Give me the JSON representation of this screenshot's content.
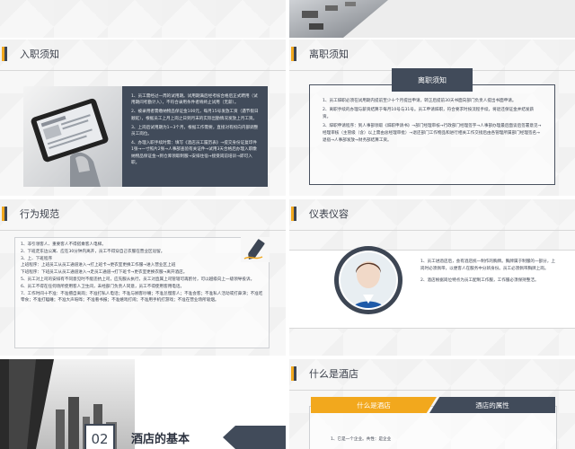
{
  "slides": {
    "ruzhi": {
      "title": "入职须知",
      "text": [
        "1、员工需经过一周的试用期。试用期满后经考核合格后正式聘用（试用期间考勤计入），不符合录用条件者将终止试用（无薪）。",
        "2、被录用者需缴纳物品保证金100元，每月15号发放工资（遇节假日顺延），根据员工上月上岗之日到月末的实际出勤情况发放上月工资。",
        "3、上岗后试用期为1~3个月，根据工作需要，直接对有权向内部调整员工岗位。",
        "4、办理入职手续时需：填写《酒店员工履历表》→提交身份证复印件1张→一寸照片2张→人事部查验有关证件→试用3天合格后办理入职缴纳物品保证金→到仓库领取制服→安排住宿→接受岗前培训→即可入职。"
      ]
    },
    "lizhi": {
      "title": "离职须知",
      "tag": "离职须知",
      "text": [
        "1、员工辞职必须在试用期内提前至少十个月提出申请，转正后提前30天书面向部门负责人提出书面申请。",
        "2、离职手续的办理与薪资结算于每月10号与31号。员工申请辞职，符合要求时按流程手续，将退还保证金并结发薪资。",
        "3、辞职申请程序：到人事部领取《辞职申请书》→部门经理审核→行政部门经理签字→人事部办理最后面谈后签署意见→经理审核（主管级（含）以上需由总经理审批）→退还部门工作物品和进行相关工作交接后由各管理所属部门经理签名→退宿→人事部发放→财务部结算工资。"
      ]
    },
    "xingwei": {
      "title": "行为规范",
      "text": [
        "1、非引领客人、重要客人不得搭乘客人电梯。",
        "2、下班走东边公寓、应在30分钟内离开，员工不得穿自己衣服在营业区逗留。",
        "3、上、下班程序",
        "上班程序：上班员工从员工通道进入→打上班卡→更衣室更换工作服→进入营业区上班",
        "下班程序：下班员工从员工通道进入→走员工通道→打下班卡→更衣室更换衣服→离开酒店。",
        "5、员工对上司的安排有不同意见时不能违抗上司，应先服从执行，员工对直属上司管辖可再酌付，可以越级向上一级领导投诉。",
        "6、员工不得在任何场所使用客人卫生间，未经部门负责人同意，员工不得使用客用电话。",
        "7、工作时间十不准：不准擅自离岗；不准打私人电话；不准与顾客吵嘴；不准怠慢客人；不准会客；不准私人活动或打鼻涕；不准吃零食；不准打瞌睡；不准大声喧哗；不准看书报；不准嬉戏打闹；不准用手机打游戏；不准在营业场所吸烟。"
      ]
    },
    "yibiao": {
      "title": "仪表仪容",
      "text": [
        "1、员工进酒店后，会有酒店统一制作的胸牌。胸牌属于制服的一部分，上岗时必须佩带，以便客人在服务中分辨身份。员工必须佩带胸牌上岗。",
        "2、酒店根据岗位特点为员工配制工作服，工作服必须保持整洁。"
      ]
    },
    "section": {
      "number": "02",
      "title": "酒店的基本"
    },
    "shenme": {
      "title": "什么是酒店",
      "tab_left": "什么是酒店",
      "tab_right": "酒店的属性",
      "snippet": "1、它是一个企业。共性：是企业"
    }
  },
  "colors": {
    "accent": "#f2a81d",
    "dark": "#414b5a",
    "background": "#f7f7f7"
  }
}
